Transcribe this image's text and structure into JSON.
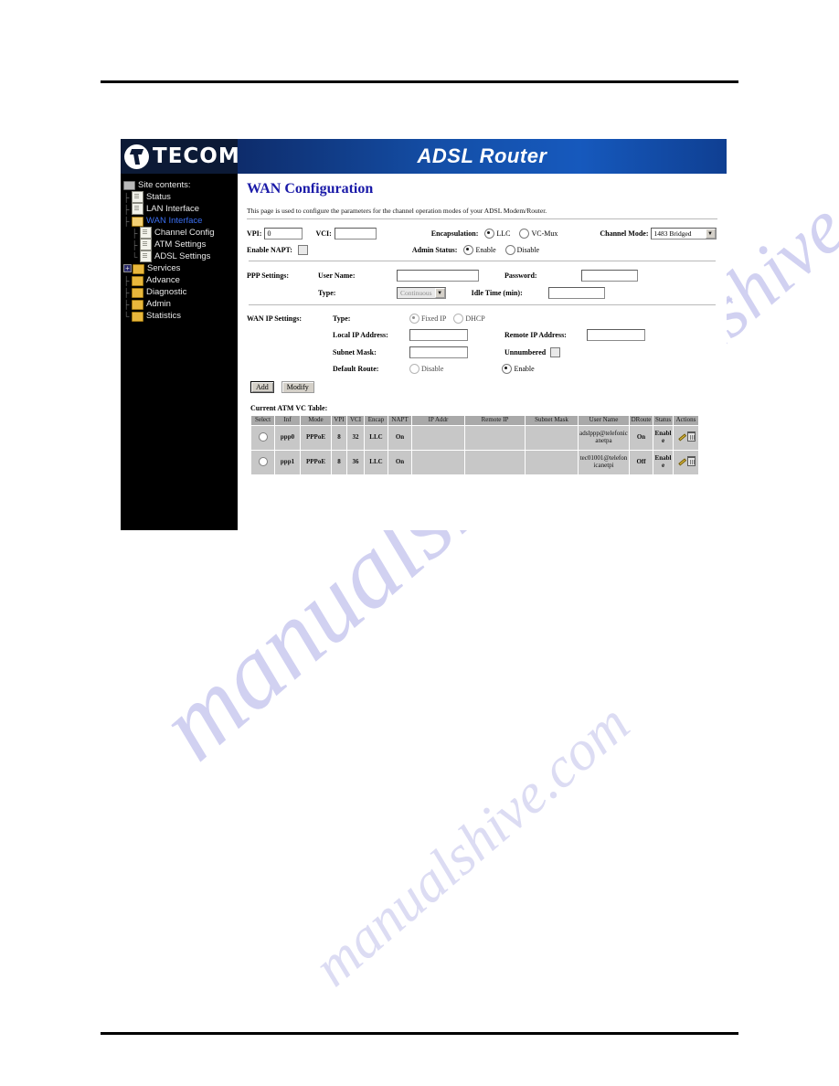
{
  "document": {
    "watermark": "manualshive.com"
  },
  "banner": {
    "logo_text": "TECOM",
    "title": "ADSL Router"
  },
  "sidebar": {
    "root_label": "Site contents:",
    "items": [
      {
        "label": "Status",
        "icon": "page-icon",
        "level": 1,
        "selected": false
      },
      {
        "label": "LAN Interface",
        "icon": "page-icon",
        "level": 1,
        "selected": false
      },
      {
        "label": "WAN Interface",
        "icon": "folder-open-icon",
        "level": 1,
        "selected": true
      },
      {
        "label": "Channel Config",
        "icon": "page-icon",
        "level": 2,
        "selected": false
      },
      {
        "label": "ATM Settings",
        "icon": "page-icon",
        "level": 2,
        "selected": false
      },
      {
        "label": "ADSL Settings",
        "icon": "page-icon",
        "level": 2,
        "selected": false
      },
      {
        "label": "Services",
        "icon": "folder-icon",
        "level": 1,
        "selected": false,
        "expander": "+"
      },
      {
        "label": "Advance",
        "icon": "folder-icon",
        "level": 1,
        "selected": false
      },
      {
        "label": "Diagnostic",
        "icon": "folder-icon",
        "level": 1,
        "selected": false
      },
      {
        "label": "Admin",
        "icon": "folder-icon",
        "level": 1,
        "selected": false
      },
      {
        "label": "Statistics",
        "icon": "folder-icon",
        "level": 1,
        "selected": false
      }
    ]
  },
  "page": {
    "title": "WAN Configuration",
    "description": "This page is used to configure the parameters for the channel operation modes of your ADSL Modem/Router."
  },
  "atm_form": {
    "vpi_label": "VPI:",
    "vpi_value": "0",
    "vci_label": "VCI:",
    "vci_value": "",
    "encapsulation_label": "Encapsulation:",
    "encap_llc_label": "LLC",
    "encap_vcmux_label": "VC-Mux",
    "encap_selected": "LLC",
    "channel_mode_label": "Channel Mode:",
    "channel_mode_value": "1483 Bridged",
    "enable_napt_label": "Enable NAPT:",
    "enable_napt_checked": false,
    "admin_status_label": "Admin Status:",
    "admin_enable_label": "Enable",
    "admin_disable_label": "Disable",
    "admin_selected": "Enable"
  },
  "ppp_settings": {
    "section_label": "PPP Settings:",
    "user_name_label": "User Name:",
    "user_name_value": "",
    "password_label": "Password:",
    "password_value": "",
    "type_label": "Type:",
    "type_value": "Continuous",
    "idle_time_label": "Idle Time (min):",
    "idle_time_value": ""
  },
  "wan_ip_settings": {
    "section_label": "WAN IP Settings:",
    "type_label": "Type:",
    "fixed_ip_label": "Fixed IP",
    "dhcp_label": "DHCP",
    "type_selected": "Fixed IP",
    "local_ip_label": "Local IP Address:",
    "local_ip_value": "",
    "remote_ip_label": "Remote IP Address:",
    "remote_ip_value": "",
    "subnet_mask_label": "Subnet Mask:",
    "subnet_mask_value": "",
    "unnumbered_label": "Unnumbered",
    "unnumbered_checked": false,
    "default_route_label": "Default Route:",
    "default_route_disable_label": "Disable",
    "default_route_enable_label": "Enable",
    "default_route_selected": "Enable"
  },
  "buttons": {
    "add_label": "Add",
    "modify_label": "Modify"
  },
  "vc_table": {
    "caption": "Current ATM VC Table:",
    "columns": [
      "Select",
      "Inf",
      "Mode",
      "VPI",
      "VCI",
      "Encap",
      "NAPT",
      "IP Addr",
      "Remote IP",
      "Subnet Mask",
      "User Name",
      "DRoute",
      "Status",
      "Actions"
    ],
    "rows": [
      {
        "select": false,
        "inf": "ppp0",
        "mode": "PPPoE",
        "vpi": "8",
        "vci": "32",
        "encap": "LLC",
        "napt": "On",
        "ip_addr": "",
        "remote_ip": "",
        "subnet_mask": "",
        "user_name": "adslppp@telefonicanetpa",
        "droute": "On",
        "status": "Enable"
      },
      {
        "select": false,
        "inf": "ppp1",
        "mode": "PPPoE",
        "vpi": "8",
        "vci": "36",
        "encap": "LLC",
        "napt": "On",
        "ip_addr": "",
        "remote_ip": "",
        "subnet_mask": "",
        "user_name": "tec01001@telefonicanetpi",
        "droute": "Off",
        "status": "Enable"
      }
    ]
  },
  "colors": {
    "banner_dark": "#0c1a36",
    "banner_blue": "#1659bd",
    "title_blue": "#1a1aa8",
    "sidebar_bg": "#000000",
    "selected_link": "#3a6ef0",
    "table_header": "#a9a9a9",
    "table_cell": "#c7c7c7",
    "watermark": "#c9c9ef"
  }
}
